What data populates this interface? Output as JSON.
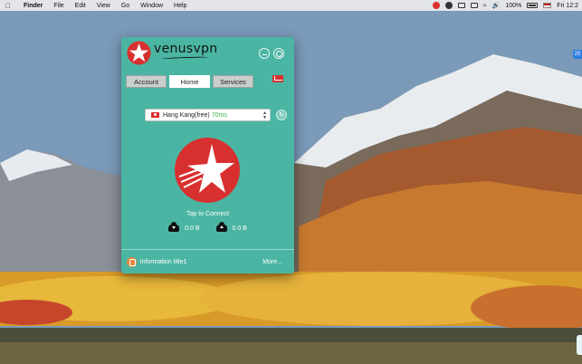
{
  "menubar": {
    "apple_icon": "apple-icon",
    "app_name": "Finder",
    "items": [
      "File",
      "Edit",
      "View",
      "Go",
      "Window",
      "Help"
    ],
    "status": {
      "battery": "100%",
      "clock": "Fri 12:2"
    }
  },
  "desktop": {
    "badge": "20"
  },
  "app": {
    "brand": "venusvpn",
    "tabs": [
      {
        "label": "Account",
        "active": false
      },
      {
        "label": "Home",
        "active": true
      },
      {
        "label": "Services",
        "active": false
      }
    ],
    "server": {
      "name": "Hang Kang(free)",
      "latency": "70ms"
    },
    "connect_label": "Tap to Connect",
    "stats": {
      "download": "0.0 B",
      "upload": "0.0 B"
    },
    "footer": {
      "info_title": "information title1",
      "more": "More..."
    },
    "colors": {
      "background": "#4bb5a3",
      "accent_red": "#d8302f",
      "latency_green": "#39b54a"
    }
  }
}
